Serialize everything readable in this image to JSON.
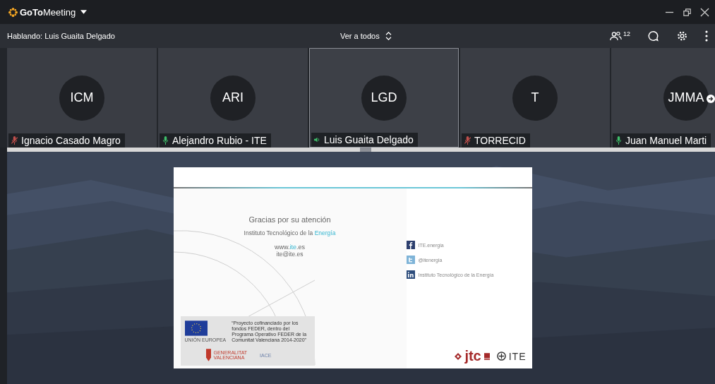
{
  "app": {
    "logo_bold": "GoTo",
    "logo_rest": "Meeting"
  },
  "toolbar": {
    "speaking": "Hablando: Luis Guaita Delgado",
    "view": "Ver a todos",
    "attendee_count": "12"
  },
  "participants": [
    {
      "initials": "ICM",
      "name": "Ignacio Casado Magro",
      "muted": true,
      "speaking": false,
      "selected": false
    },
    {
      "initials": "ARI",
      "name": "Alejandro Rubio - ITE",
      "muted": false,
      "speaking": false,
      "selected": false
    },
    {
      "initials": "LGD",
      "name": "Luis Guaita Delgado",
      "muted": false,
      "speaking": true,
      "selected": true
    },
    {
      "initials": "T",
      "name": "TORRECID",
      "muted": true,
      "speaking": false,
      "selected": false
    },
    {
      "initials": "JMMA",
      "name": "Juan Manuel Marti",
      "muted": false,
      "speaking": false,
      "selected": false
    }
  ],
  "slide": {
    "title": "Gracias por su atención",
    "institute": [
      {
        "text": "Instituto Tecnológico de la ",
        "accent": false
      },
      {
        "text": "Energía",
        "accent": true
      }
    ],
    "web": [
      {
        "text": "www.",
        "accent": false
      },
      {
        "text": "ite",
        "accent": true
      },
      {
        "text": ".es",
        "accent": false
      }
    ],
    "email": "ite@ite.es",
    "social": [
      {
        "kind": "facebook",
        "label": "ITE.energia"
      },
      {
        "kind": "twitter",
        "label": "@itenergia"
      },
      {
        "kind": "linkedin",
        "label": "Instituto Tecnológico de la Energía"
      }
    ],
    "funding_note": "“Proyecto cofinanciado por los fondos FEDER, dentro del Programa Operativo FEDER de la Comunitat Valenciana 2014-2020”",
    "eu_label": "UNIÓN EUROPEA",
    "region_logo": [
      "GENERALITAT",
      "VALENCIANA"
    ],
    "partner_logo": "IACE",
    "jtc_logo": "jtc",
    "ite_logo": "ITE"
  }
}
